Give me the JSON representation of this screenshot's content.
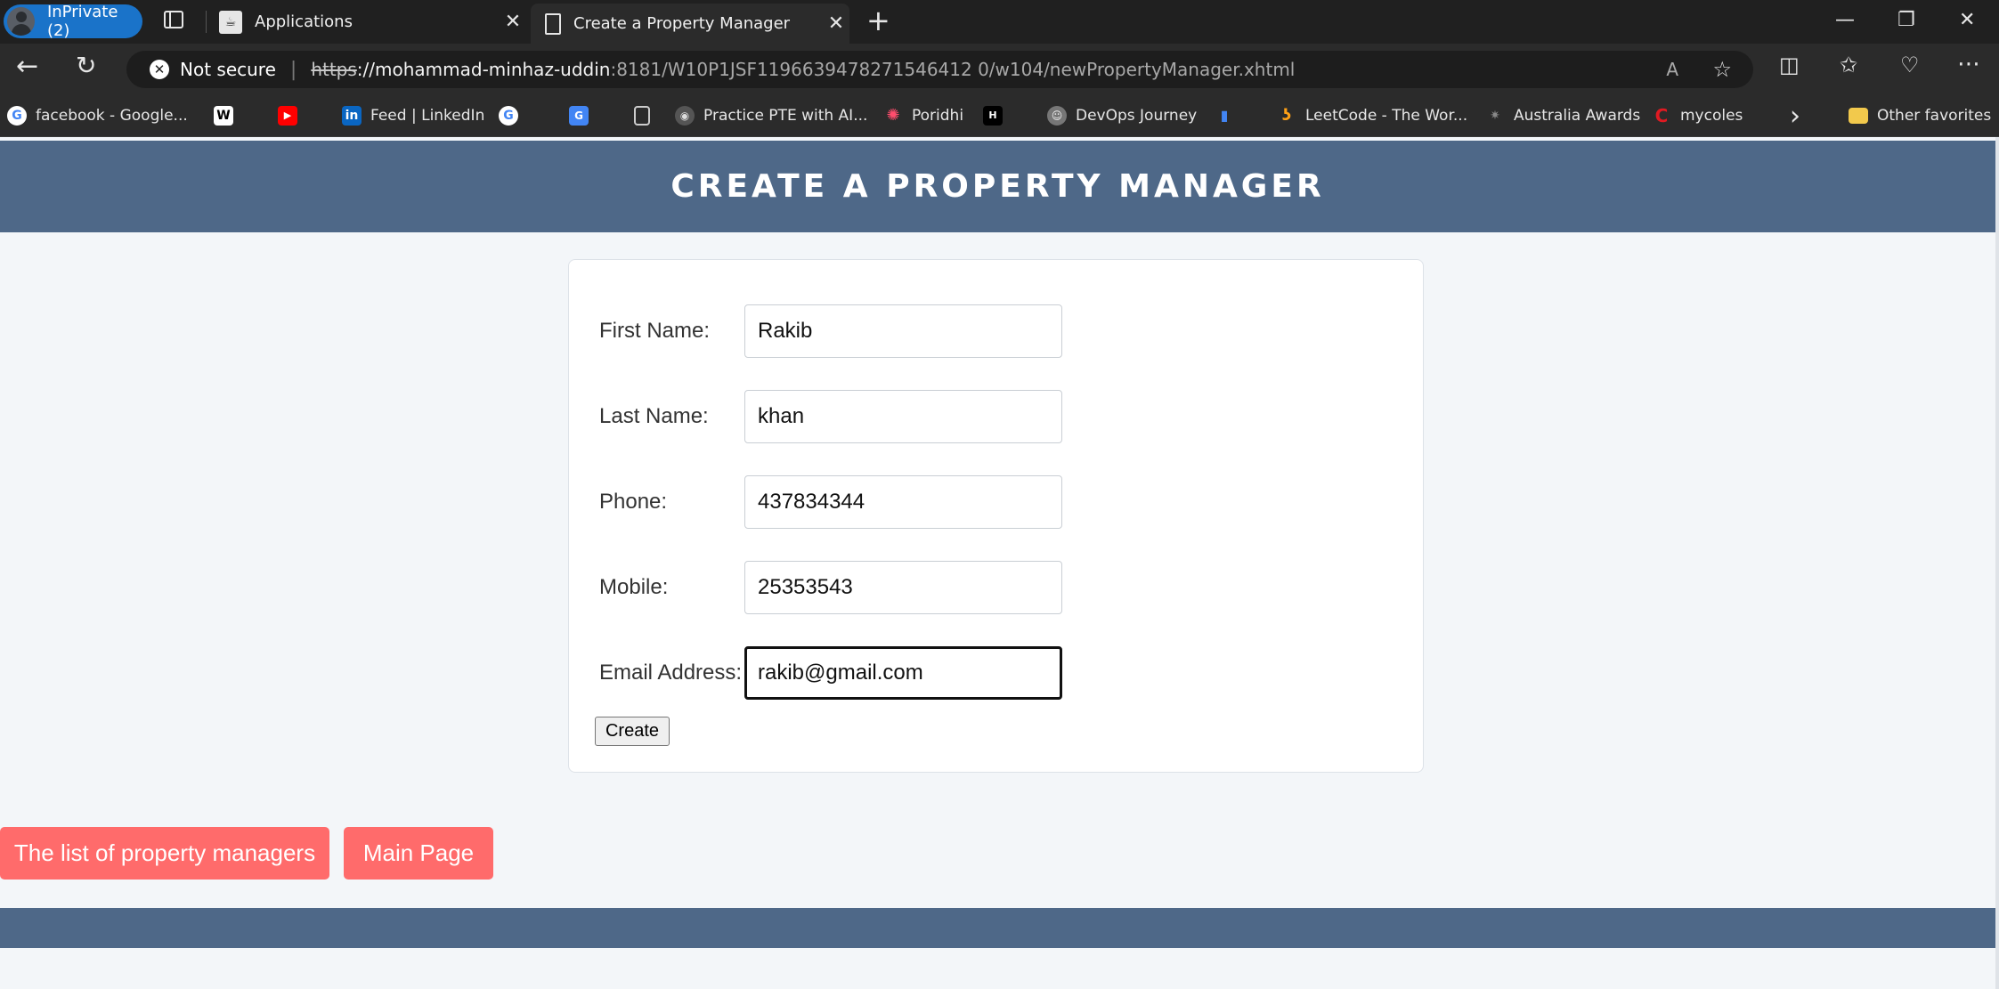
{
  "browser": {
    "profile_label": "InPrivate (2)",
    "tabs": [
      {
        "label": "Applications",
        "close": "✕"
      },
      {
        "label": "Create a Property Manager",
        "close": "✕"
      }
    ],
    "new_tab": "+",
    "window_controls": {
      "minimize": "—",
      "restore": "❐",
      "close": "✕"
    },
    "address": {
      "security_label": "Not secure",
      "protocol": "https",
      "host": "://mohammad-minhaz-uddin",
      "path": ":8181/W10P1JSF1196639478271546412 0/w104/newPropertyManager.xhtml"
    },
    "favorites": [
      {
        "label": "facebook - Google...",
        "icon": "google-icon",
        "color": "#4285f4"
      },
      {
        "label": "",
        "icon": "wikipedia-icon",
        "color": "#ffffff"
      },
      {
        "label": "",
        "icon": "youtube-icon",
        "color": "#ff0000"
      },
      {
        "label": "Feed | LinkedIn",
        "icon": "linkedin-icon",
        "color": "#0a66c2"
      },
      {
        "label": "",
        "icon": "google-icon",
        "color": "#4285f4"
      },
      {
        "label": "",
        "icon": "google-translate-icon",
        "color": "#4285f4"
      },
      {
        "label": "",
        "icon": "document-icon",
        "color": "#cccccc"
      },
      {
        "label": "Practice PTE with AI...",
        "icon": "pte-icon",
        "color": "#9aa0a6"
      },
      {
        "label": "Poridhi",
        "icon": "poridhi-icon",
        "color": "#ff4d6d"
      },
      {
        "label": "",
        "icon": "hackerrank-icon",
        "color": "#1ba94c"
      },
      {
        "label": "DevOps Journey",
        "icon": "devops-icon",
        "color": "#9aa0a6"
      },
      {
        "label": "",
        "icon": "chart-icon",
        "color": "#4285f4"
      },
      {
        "label": "LeetCode - The Wor...",
        "icon": "leetcode-icon",
        "color": "#ffa116"
      },
      {
        "label": "Australia Awards",
        "icon": "australia-awards-icon",
        "color": "#333333"
      },
      {
        "label": "mycoles",
        "icon": "coles-icon",
        "color": "#e01a22"
      }
    ],
    "favorites_more": "›",
    "other_favorites": "Other favorites"
  },
  "page": {
    "title": "CREATE A PROPERTY MANAGER",
    "form": {
      "fields": [
        {
          "label": "First Name:",
          "value": "Rakib"
        },
        {
          "label": "Last Name:",
          "value": "khan"
        },
        {
          "label": "Phone:",
          "value": "437834344"
        },
        {
          "label": "Mobile:",
          "value": "25353543"
        },
        {
          "label": "Email Address:",
          "value": "rakib@gmail.com"
        }
      ],
      "submit_label": "Create"
    },
    "buttons": {
      "list_label": "The list of property managers",
      "main_label": "Main Page"
    }
  },
  "colors": {
    "header": "#4e6888",
    "button": "#ff6b6b",
    "background": "#f3f6f9"
  }
}
